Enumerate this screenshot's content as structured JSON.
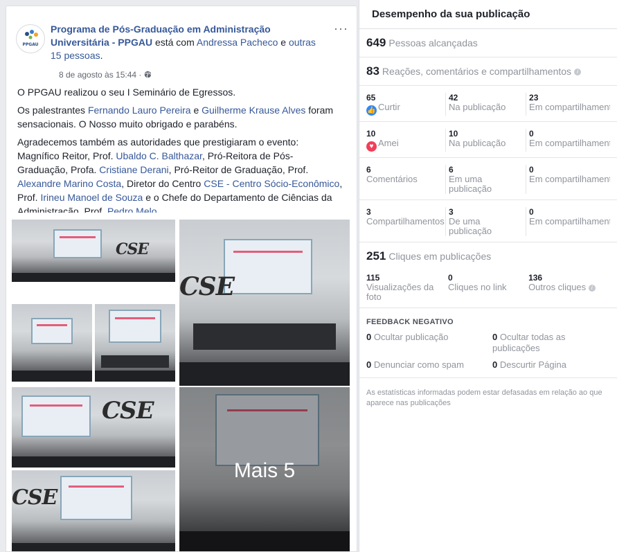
{
  "post": {
    "logo_text": "PPGAU",
    "page_name": "Programa de Pós-Graduação em Administração Universitária - PPGAU",
    "with_text": " está com ",
    "tagged_person": "Andressa Pacheco",
    "and_text": " e ",
    "others": "outras 15 pessoas",
    "end_punct": ".",
    "date": "8 de agosto às 15:44 · ",
    "globe_icon": "globe-icon",
    "more_icon": "···",
    "p1": "O PPGAU realizou o seu I Seminário de Egressos.",
    "p2": {
      "t1": "Os palestrantes ",
      "l1": "Fernando Lauro Pereira",
      "t2": " e ",
      "l2": "Guilherme Krause Alves",
      "t3": " foram sensacionais. O Nosso muito obrigado e parabéns."
    },
    "p3": {
      "t1": "Agradecemos também as autoridades que prestigiaram o evento: Magnífico Reitor, Prof. ",
      "l1": "Ubaldo C. Balthazar",
      "t2": ", Pró-Reitora de Pós-Graduação, Profa. ",
      "l2": "Cristiane Derani",
      "t3": ", Pró-Reitor de Graduação, Prof. ",
      "l3": "Alexandre Marino Costa",
      "t4": ", Diretor do Centro ",
      "l4": "CSE - Centro Sócio-Econômico",
      "t5": ", Prof. ",
      "l5": "Irineu Manoel de Souza",
      "t6": " e o Chefe do Departamento de Ciências da Administração, Prof. ",
      "l6": "Pedro Melo"
    },
    "photo_sign": "CSE",
    "more_photos": "Mais 5"
  },
  "stats": {
    "title": "Desempenho da sua publicação",
    "reach": {
      "value": "649",
      "label": "Pessoas alcançadas"
    },
    "reactions": {
      "value": "83",
      "label": "Reações, comentários e compartilhamentos"
    },
    "info_icon": "i",
    "rows": [
      {
        "v1": "65",
        "l1": "Curtir",
        "icon": "like",
        "v2": "42",
        "l2": "Na publicação",
        "v3": "23",
        "l3": "Em compartilhamentos"
      },
      {
        "v1": "10",
        "l1": "Amei",
        "icon": "love",
        "v2": "10",
        "l2": "Na publicação",
        "v3": "0",
        "l3": "Em compartilhamentos"
      },
      {
        "v1": "6",
        "l1": "Comentários",
        "icon": "",
        "v2": "6",
        "l2": "Em uma publicação",
        "v3": "0",
        "l3": "Em compartilhamentos"
      },
      {
        "v1": "3",
        "l1": "Compartilhamentos",
        "icon": "",
        "v2": "3",
        "l2": "De uma publicação",
        "v3": "0",
        "l3": "Em compartilhamentos"
      }
    ],
    "clicks": {
      "value": "251",
      "label": "Cliques em publicações"
    },
    "click_row": {
      "v1": "115",
      "l1": "Visualizações da foto",
      "v2": "0",
      "l2": "Cliques no link",
      "v3": "136",
      "l3": "Outros cliques"
    },
    "negative": {
      "title": "FEEDBACK NEGATIVO",
      "items": [
        {
          "value": "0",
          "label": " Ocultar publicação"
        },
        {
          "value": "0",
          "label": " Ocultar todas as publicações"
        },
        {
          "value": "0",
          "label": " Denunciar como spam"
        },
        {
          "value": "0",
          "label": " Descurtir Página"
        }
      ]
    },
    "note": "As estatísticas informadas podem estar defasadas em relação ao que aparece nas publicações"
  }
}
